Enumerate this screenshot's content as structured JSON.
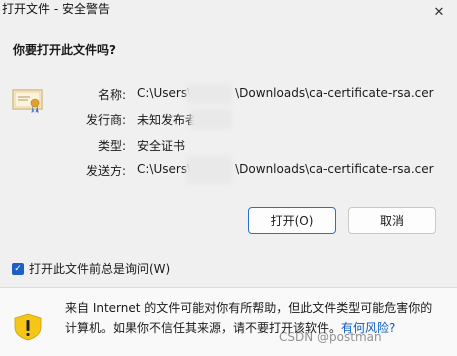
{
  "window": {
    "title": "打开文件 - 安全警告",
    "close_glyph": "✕"
  },
  "dialog": {
    "question": "你要打开此文件吗?",
    "fields": {
      "name_label": "名称:",
      "name_value_prefix": "C:\\Users\\",
      "name_value_suffix": "\\Downloads\\ca-certificate-rsa.cer",
      "publisher_label": "发行商:",
      "publisher_value": "未知发布者",
      "type_label": "类型:",
      "type_value": "安全证书",
      "from_label": "发送方:",
      "from_value_prefix": "C:\\Users\\",
      "from_value_suffix": "\\Downloads\\ca-certificate-rsa.cer"
    },
    "buttons": {
      "open_label": "打开(O)",
      "cancel_label": "取消"
    },
    "checkbox": {
      "label": "打开此文件前总是询问(W)",
      "checked": true
    },
    "warning": {
      "line1": "来自 Internet 的文件可能对你有所帮助，但此文件类型可能危害你的",
      "line2_start": "计算机。如果你不信任其来源，请不要打开该软件。",
      "link": "有何风险?"
    },
    "watermark": {
      "text": "CSDN @postman"
    }
  },
  "colors": {
    "accent": "#1f5fc4",
    "link": "#0a5ac2",
    "warning_yellow": "#f5c518"
  }
}
